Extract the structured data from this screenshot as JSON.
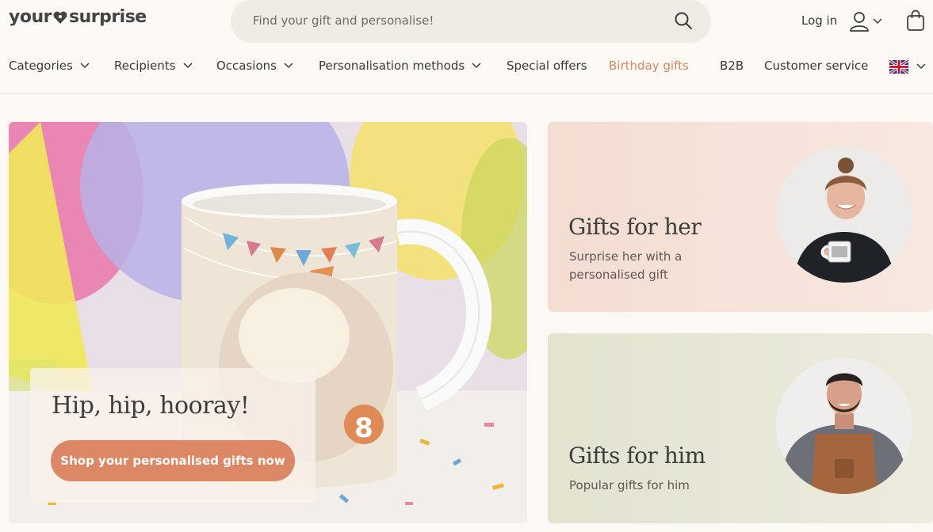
{
  "header": {
    "logo_left": "your",
    "logo_right": "surprise",
    "search_placeholder": "Find your gift and personalise!",
    "login_label": "Log in"
  },
  "nav": {
    "items": [
      {
        "label": "Categories",
        "has_menu": true
      },
      {
        "label": "Recipients",
        "has_menu": true
      },
      {
        "label": "Occasions",
        "has_menu": true
      },
      {
        "label": "Personalisation methods",
        "has_menu": true
      },
      {
        "label": "Special offers",
        "has_menu": false
      },
      {
        "label": "Birthday gifts",
        "has_menu": false
      },
      {
        "label": "B2B",
        "has_menu": false
      },
      {
        "label": "Customer service",
        "has_menu": false
      }
    ],
    "language_icon": "uk-flag-icon"
  },
  "hero": {
    "title": "Hip, hip, hooray!",
    "button_label": "Shop your personalised gifts now",
    "mug_number": "8"
  },
  "cards": {
    "her": {
      "title": "Gifts for her",
      "subtitle": "Surprise her with a personalised gift"
    },
    "him": {
      "title": "Gifts for him",
      "subtitle": "Popular gifts for him"
    }
  },
  "colors": {
    "accent": "#dc8866",
    "accent_text": "#d98866",
    "background": "#fcf9f5",
    "search_bg": "#efebe5",
    "card_her_bg": "#f4ddd2",
    "card_him_bg": "#e3e3d0"
  },
  "icons": {
    "search": "search-icon",
    "user": "user-icon",
    "bag": "shopping-bag-icon",
    "chevron": "chevron-down-icon"
  }
}
